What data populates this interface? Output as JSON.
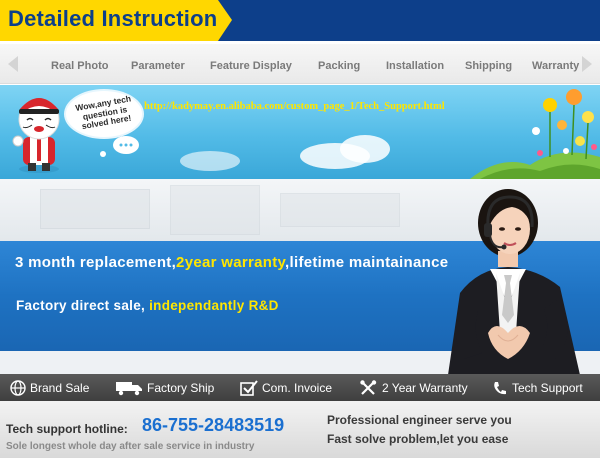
{
  "header": {
    "title": "Detailed Instruction"
  },
  "nav": {
    "tabs": [
      {
        "label": "Real Photo"
      },
      {
        "label": "Parameter"
      },
      {
        "label": "Feature Display"
      },
      {
        "label": "Packing"
      },
      {
        "label": "Installation"
      },
      {
        "label": "Shipping"
      },
      {
        "label": "Warranty"
      }
    ]
  },
  "banner": {
    "bubble_text": "Wow,any tech question is solved here!",
    "url": "http://kadymay.en.alibaba.com/custom_page_1/Tech_Support.html"
  },
  "promo": {
    "line1_a": "3 month replacement,",
    "line1_b": "2year warranty",
    "line1_c": ",lifetime maintainance",
    "line2_a": "Factory direct sale, ",
    "line2_b": "independantly R&D"
  },
  "features": [
    {
      "label": "Brand Sale",
      "icon": "globe-icon"
    },
    {
      "label": "Factory Ship",
      "icon": "truck-icon"
    },
    {
      "label": "Com. Invoice",
      "icon": "checkbox-icon"
    },
    {
      "label": "2 Year Warranty",
      "icon": "tools-icon"
    },
    {
      "label": "Tech Support",
      "icon": "phone-icon"
    }
  ],
  "footer": {
    "hotline_label": "Tech support hotline:",
    "hotline_number": "86-755-28483519",
    "note": "Sole longest whole day after sale service in industry",
    "right_line1": "Professional engineer serve you",
    "right_line2": "Fast solve problem,let you ease"
  },
  "colors": {
    "header_blue": "#0d3f8a",
    "header_yellow": "#ffd700",
    "promo_blue": "#1e72c2",
    "highlight_yellow": "#ffe600",
    "hotline_blue": "#1a6fd0"
  }
}
